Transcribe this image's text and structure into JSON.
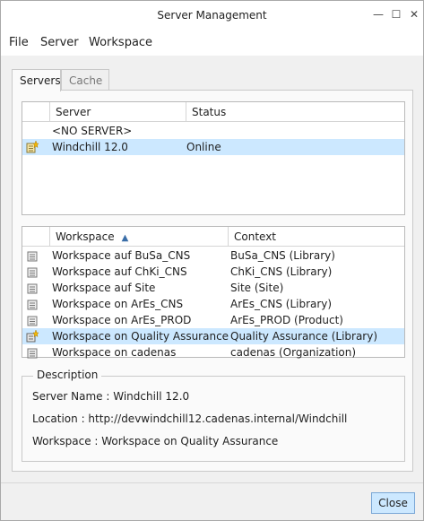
{
  "window": {
    "title": "Server Management"
  },
  "menu": {
    "file": "File",
    "server": "Server",
    "workspace": "Workspace"
  },
  "tabs": {
    "servers": "Servers",
    "cache": "Cache"
  },
  "server_table": {
    "columns": {
      "server": "Server",
      "status": "Status"
    },
    "rows": [
      {
        "server": "<NO SERVER>",
        "status": ""
      },
      {
        "server": "Windchill 12.0",
        "status": "Online",
        "selected": true
      }
    ]
  },
  "workspace_table": {
    "columns": {
      "workspace": "Workspace",
      "context": "Context"
    },
    "sort_indicator": "▲",
    "rows": [
      {
        "workspace": "Workspace auf BuSa_CNS",
        "context": "BuSa_CNS (Library)"
      },
      {
        "workspace": "Workspace auf ChKi_CNS",
        "context": "ChKi_CNS (Library)"
      },
      {
        "workspace": "Workspace auf Site",
        "context": "Site (Site)"
      },
      {
        "workspace": "Workspace on ArEs_CNS",
        "context": "ArEs_CNS (Library)"
      },
      {
        "workspace": "Workspace on ArEs_PROD",
        "context": "ArEs_PROD (Product)"
      },
      {
        "workspace": "Workspace on Quality Assurance",
        "context": "Quality Assurance (Library)",
        "selected": true
      },
      {
        "workspace": "Workspace on cadenas",
        "context": "cadenas (Organization)"
      }
    ]
  },
  "description": {
    "legend": "Description",
    "server_name": "Server Name : Windchill 12.0",
    "location": "Location : http://devwindchill12.cadenas.internal/Windchill",
    "workspace": "Workspace : Workspace on Quality Assurance"
  },
  "buttons": {
    "close": "Close"
  },
  "colors": {
    "selection": "#cce8ff",
    "close_button": "#cce8ff",
    "accent": "#3a6ea8"
  }
}
